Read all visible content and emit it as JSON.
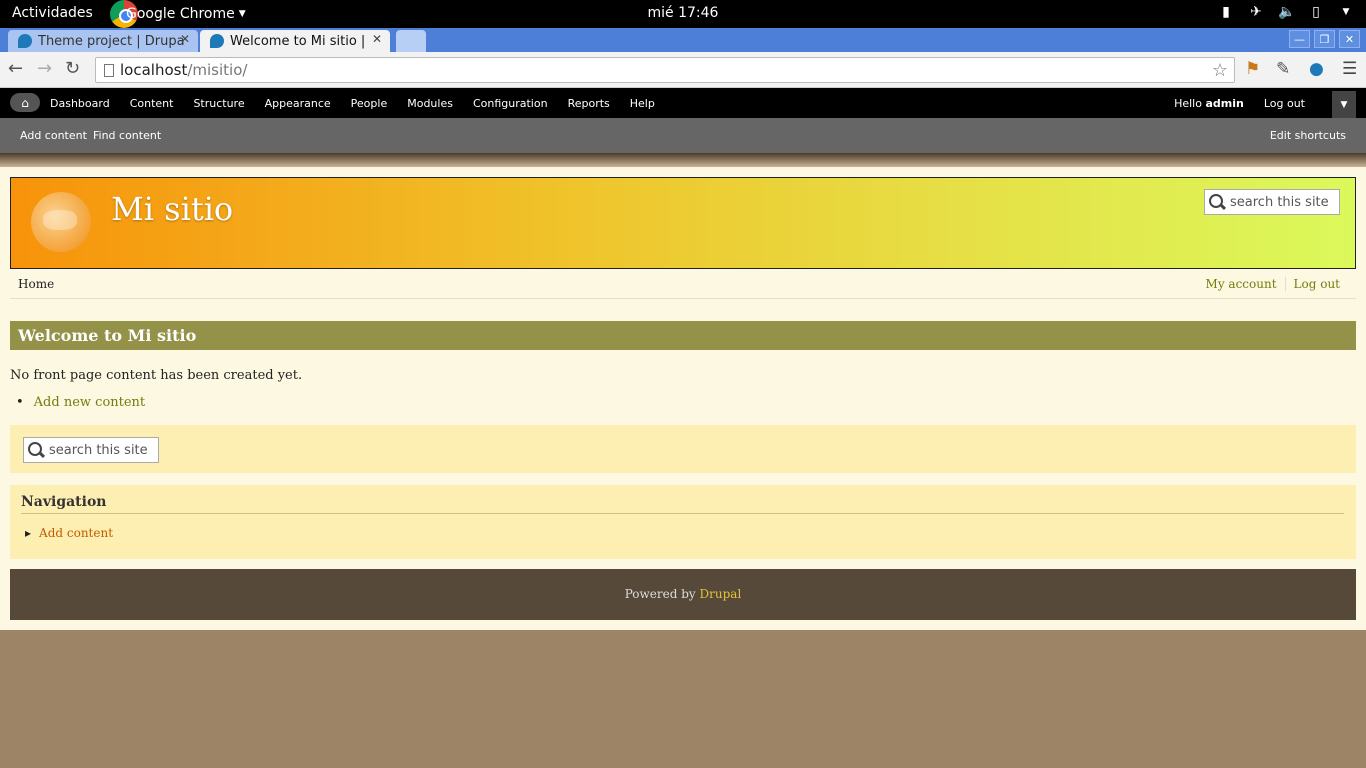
{
  "system": {
    "activities": "Actividades",
    "app_name": "Google Chrome",
    "clock": "mié 17:46",
    "icons": [
      "signal-icon",
      "airplane-icon",
      "volume-icon",
      "battery-icon",
      "chevron-down-icon"
    ]
  },
  "tabs": [
    {
      "title": "Theme project | Drupa"
    },
    {
      "title": "Welcome to Mi sitio |"
    }
  ],
  "omnibox": {
    "host": "localhost",
    "path": "/misitio/"
  },
  "admin": {
    "menu": [
      "Dashboard",
      "Content",
      "Structure",
      "Appearance",
      "People",
      "Modules",
      "Configuration",
      "Reports",
      "Help"
    ],
    "hello": "Hello",
    "user": "admin",
    "logout": "Log out"
  },
  "shortcuts": {
    "add": "Add content",
    "find": "Find content",
    "edit": "Edit shortcuts"
  },
  "site": {
    "name": "Mi sitio",
    "search_placeholder": "search this site",
    "nav_home": "Home",
    "my_account": "My account",
    "log_out": "Log out",
    "welcome": "Welcome to Mi sitio",
    "no_content": "No front page content has been created yet.",
    "add_new": "Add new content",
    "nav_title": "Navigation",
    "nav_item": "Add content",
    "footer_prefix": "Powered by",
    "footer_link": "Drupal"
  },
  "colors": {
    "header_start": "#f7930b",
    "header_end": "#dbf95b",
    "title_bar": "#939248",
    "footer": "#56493a",
    "link": "#6d7f0d"
  }
}
